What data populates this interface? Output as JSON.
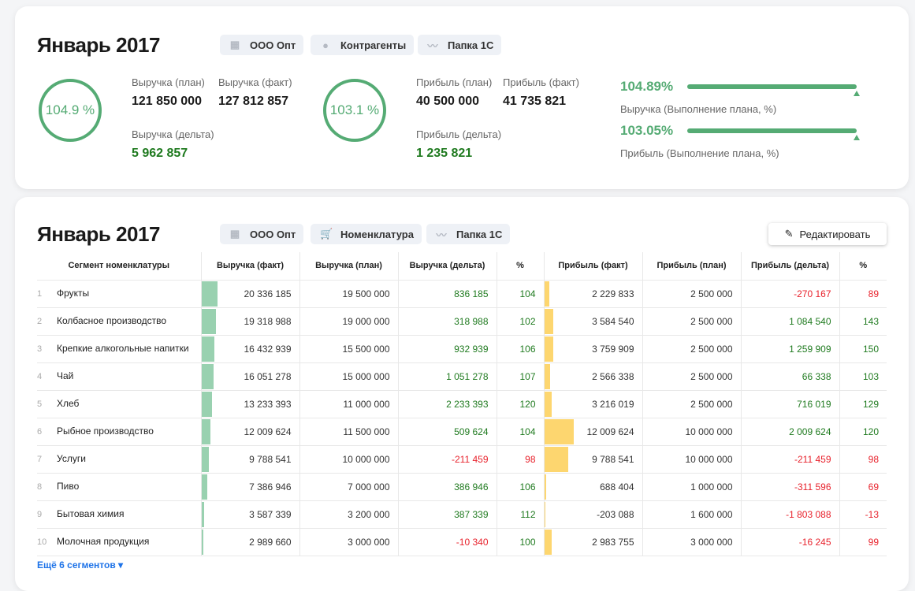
{
  "summary": {
    "title": "Январь 2017",
    "chips": [
      {
        "icon": "building-icon",
        "label": "ООО Опт"
      },
      {
        "icon": "user-icon",
        "label": "Контрагенты"
      },
      {
        "icon": "chart-line-icon",
        "label": "Папка 1С"
      }
    ],
    "revenue": {
      "ring": "104.9 %",
      "plan_label": "Выручка (план)",
      "plan": "121 850 000",
      "fact_label": "Выручка (факт)",
      "fact": "127 812 857",
      "delta_label": "Выручка (дельта)",
      "delta": "5 962 857"
    },
    "profit": {
      "ring": "103.1 %",
      "plan_label": "Прибыль (план)",
      "plan": "40 500 000",
      "fact_label": "Прибыль (факт)",
      "fact": "41 735 821",
      "delta_label": "Прибыль (дельта)",
      "delta": "1 235 821"
    },
    "progress": [
      {
        "value": "104.89%",
        "percent": 104.89,
        "label": "Выручка (Выполнение плана, %)"
      },
      {
        "value": "103.05%",
        "percent": 103.05,
        "label": "Прибыль (Выполнение плана, %)"
      }
    ]
  },
  "table_card": {
    "title": "Январь 2017",
    "chips": [
      {
        "icon": "building-icon",
        "label": "ООО Опт"
      },
      {
        "icon": "cart-icon",
        "label": "Номенклатура"
      },
      {
        "icon": "chart-line-icon",
        "label": "Папка 1С"
      }
    ],
    "edit_label": "Редактировать",
    "columns": [
      "Сегмент номенклатуры",
      "Выручка (факт)",
      "Выручка (план)",
      "Выручка (дельта)",
      "%",
      "Прибыль (факт)",
      "Прибыль (план)",
      "Прибыль (дельта)",
      "%"
    ],
    "rows": [
      [
        "1",
        "Фрукты",
        "20 336 185",
        "19 500 000",
        "836 185",
        "104",
        "2 229 833",
        "2 500 000",
        "-270 167",
        "89"
      ],
      [
        "2",
        "Колбасное производство",
        "19 318 988",
        "19 000 000",
        "318 988",
        "102",
        "3 584 540",
        "2 500 000",
        "1 084 540",
        "143"
      ],
      [
        "3",
        "Крепкие алкогольные напитки",
        "16 432 939",
        "15 500 000",
        "932 939",
        "106",
        "3 759 909",
        "2 500 000",
        "1 259 909",
        "150"
      ],
      [
        "4",
        "Чай",
        "16 051 278",
        "15 000 000",
        "1 051 278",
        "107",
        "2 566 338",
        "2 500 000",
        "66 338",
        "103"
      ],
      [
        "5",
        "Хлеб",
        "13 233 393",
        "11 000 000",
        "2 233 393",
        "120",
        "3 216 019",
        "2 500 000",
        "716 019",
        "129"
      ],
      [
        "6",
        "Рыбное производство",
        "12 009 624",
        "11 500 000",
        "509 624",
        "104",
        "12 009 624",
        "10 000 000",
        "2 009 624",
        "120"
      ],
      [
        "7",
        "Услуги",
        "9 788 541",
        "10 000 000",
        "-211 459",
        "98",
        "9 788 541",
        "10 000 000",
        "-211 459",
        "98"
      ],
      [
        "8",
        "Пиво",
        "7 386 946",
        "7 000 000",
        "386 946",
        "106",
        "688 404",
        "1 000 000",
        "-311 596",
        "69"
      ],
      [
        "9",
        "Бытовая химия",
        "3 587 339",
        "3 200 000",
        "387 339",
        "112",
        "-203 088",
        "1 600 000",
        "-1 803 088",
        "-13"
      ],
      [
        "10",
        "Молочная продукция",
        "2 989 660",
        "3 000 000",
        "-10 340",
        "100",
        "2 983 755",
        "3 000 000",
        "-16 245",
        "99"
      ]
    ],
    "more_label": "Ещё 6 сегментов ▾"
  },
  "colors": {
    "accent": "#55ab74",
    "revenue_bar": "#99d1b0",
    "profit_bar": "#fdd66f",
    "positive": "#1f7a1f",
    "negative": "#e8222c",
    "link": "#1e73e8"
  }
}
